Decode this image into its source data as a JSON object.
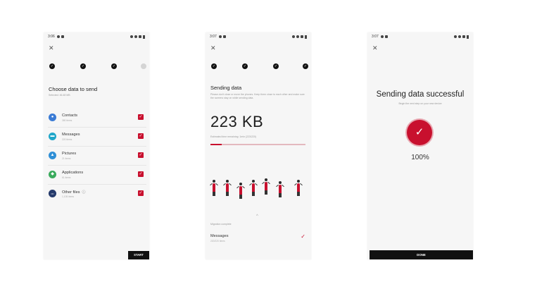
{
  "colors": {
    "accent": "#c8102e",
    "dark": "#111111",
    "background": "#f6f6f6"
  },
  "screen1": {
    "status_time": "3:06",
    "close_icon": "close-icon",
    "steps": [
      "✓",
      "✓",
      "✓",
      ""
    ],
    "title": "Choose data to send",
    "subtitle": "Selected: 46.48 MB",
    "items": [
      {
        "label": "Contacts",
        "sub": "380 items",
        "icon": "contacts-icon",
        "icon_char": "●",
        "color": "#3a7bd5",
        "checked": true
      },
      {
        "label": "Messages",
        "sub": "220 items",
        "icon": "messages-icon",
        "icon_char": "▬",
        "color": "#1fa6c9",
        "checked": true
      },
      {
        "label": "Pictures",
        "sub": "21 items",
        "icon": "pictures-icon",
        "icon_char": "▲",
        "color": "#2f8fd6",
        "checked": true
      },
      {
        "label": "Applications",
        "sub": "61 items",
        "icon": "applications-icon",
        "icon_char": "◆",
        "color": "#3aaa5c",
        "checked": true
      },
      {
        "label": "Other files",
        "sub": "1,105 items",
        "icon": "other-files-icon",
        "icon_char": "•••",
        "color": "#253a6b",
        "checked": true
      }
    ],
    "info_icon": "ⓘ",
    "start_label": "START"
  },
  "screen2": {
    "status_time": "3:07",
    "close_icon": "close-icon",
    "steps": [
      "✓",
      "✓",
      "✓",
      "✓"
    ],
    "title": "Sending data",
    "description": "Please don't close or move the phones. Keep them close to each other and make sure the screens stay on while sending data.",
    "size": "223 KB",
    "time_remaining": "Estimated time remaining: 1min (223/220)",
    "progress": 0.12,
    "caret": "^",
    "section_label": "Migration complete",
    "item_label": "Messages",
    "item_sub": "220/220 items"
  },
  "screen3": {
    "status_time": "3:07",
    "close_icon": "close-icon",
    "title": "Sending data successful",
    "subtitle": "Begin the next step on your new device",
    "check": "✓",
    "percent": "100%",
    "done_label": "DONE"
  }
}
